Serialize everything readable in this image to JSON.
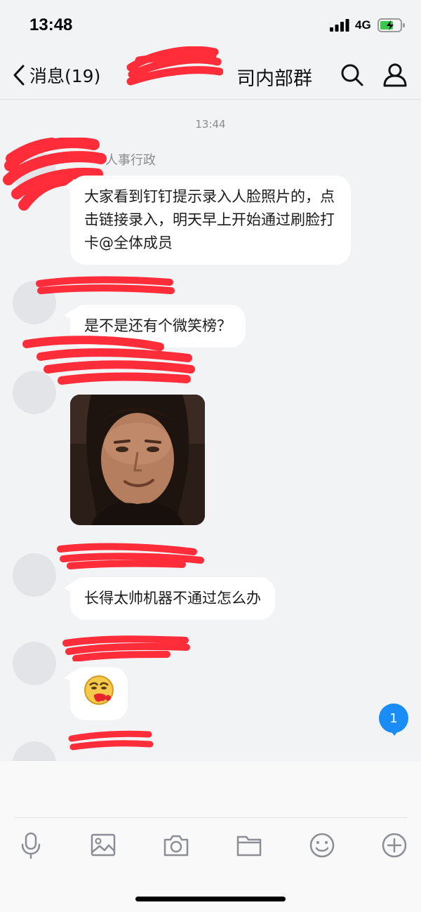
{
  "status_bar": {
    "time": "13:48",
    "network": "4G"
  },
  "nav": {
    "back_label": "消息(19)",
    "title": "司内部群"
  },
  "chat": {
    "timestamp": "13:44",
    "messages": [
      {
        "sender": "人事行政",
        "text": "大家看到钉钉提示录入人脸照片的，点击链接录入，明天早上开始通过刷脸打卡@全体成员"
      },
      {
        "sender": "",
        "text": "是不是还有个微笑榜？"
      },
      {
        "sender": "",
        "type": "image"
      },
      {
        "sender": "",
        "text": "长得太帅机器不通过怎么办"
      },
      {
        "sender": "",
        "type": "emoji",
        "emoji": "😷"
      }
    ]
  },
  "unread_count": "1",
  "colors": {
    "accent": "#1a8cf5",
    "redaction": "#ff2d3a"
  },
  "composer": {
    "icons": [
      "microphone-icon",
      "image-icon",
      "camera-icon",
      "folder-icon",
      "emoji-icon",
      "plus-icon"
    ]
  }
}
